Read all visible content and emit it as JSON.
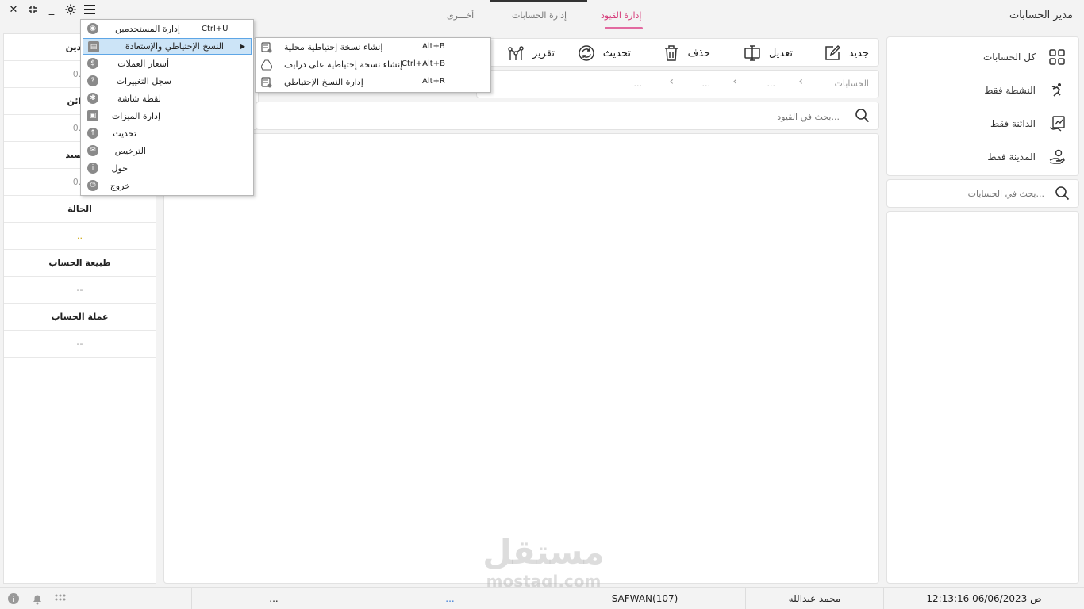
{
  "app": {
    "title": "مدير الحسابات"
  },
  "tabs": [
    {
      "label": "إدارة القيود",
      "active": true
    },
    {
      "label": "إدارة الحسابات",
      "active": false
    },
    {
      "label": "أخـــرى",
      "active": false
    }
  ],
  "window_controls": [
    "menu-icon",
    "gear-icon",
    "minimize-icon",
    "restore-icon",
    "close-icon"
  ],
  "sidebar": {
    "items": [
      {
        "label": "كل الحسابات",
        "icon": "grid-icon"
      },
      {
        "label": "النشطة فقط",
        "icon": "runner-icon"
      },
      {
        "label": "الدائنة فقط",
        "icon": "chart-hand-icon"
      },
      {
        "label": "المدينة فقط",
        "icon": "hand-coin-icon"
      }
    ],
    "search_placeholder": "بحث في الحسابات..."
  },
  "toolbar": {
    "new_label": "جديد",
    "edit_label": "تعديل",
    "delete_label": "حذف",
    "refresh_label": "تحديث",
    "report_label": "تقرير"
  },
  "breadcrumb": {
    "root": "الحسابات",
    "items": [
      "...",
      "...",
      "..."
    ]
  },
  "main_search": {
    "placeholder": "بحث في القيود..."
  },
  "details": {
    "rows": [
      {
        "head": "المدين",
        "value": "0.0"
      },
      {
        "head": "الدائن",
        "value": "0.0"
      },
      {
        "head": "الرصيد",
        "value": "0.0"
      },
      {
        "head": "الحالة",
        "value": ".."
      },
      {
        "head": "طبيعة الحساب",
        "value": "--"
      },
      {
        "head": "عملة الحساب",
        "value": "--"
      }
    ]
  },
  "menu": {
    "items": [
      {
        "label": "إدارة المستخدمين",
        "shortcut": "Ctrl+U",
        "icon": "users-icon"
      },
      {
        "label": "النسخ الإحتياطي والإستعادة",
        "shortcut": "",
        "icon": "backup-icon",
        "highlighted": true,
        "has_submenu": true
      },
      {
        "label": "أسعار العملات",
        "shortcut": "",
        "icon": "currency-icon"
      },
      {
        "label": "سجل التغييرات",
        "shortcut": "",
        "icon": "changelog-icon"
      },
      {
        "label": "لقطة شاشة",
        "shortcut": "",
        "icon": "screenshot-icon"
      },
      {
        "label": "إدارة الميزات",
        "shortcut": "",
        "icon": "features-icon"
      },
      {
        "label": "تحديث",
        "shortcut": "",
        "icon": "update-icon"
      },
      {
        "label": "الترخيص",
        "shortcut": "",
        "icon": "license-icon"
      },
      {
        "label": "حول",
        "shortcut": "",
        "icon": "info-icon"
      },
      {
        "label": "خروج",
        "shortcut": "",
        "icon": "power-icon"
      }
    ]
  },
  "submenu": {
    "items": [
      {
        "label": "إنشاء نسخة إحتياطية محلية",
        "shortcut": "Alt+B",
        "icon": "local-backup-icon"
      },
      {
        "label": "إنشاء نسخة إحتياطية على درايف",
        "shortcut": "Ctrl+Alt+B",
        "icon": "drive-icon"
      },
      {
        "label": "إدارة النسخ الإحتياطي",
        "shortcut": "Alt+R",
        "icon": "backup-manage-icon"
      }
    ]
  },
  "statusbar": {
    "datetime": "12:13:16 06/06/2023 ص",
    "user": "محمد عبدالله",
    "machine": "SAFWAN(107)",
    "cell4": "...",
    "cell5": "..."
  },
  "watermark": {
    "ar": "مستقل",
    "en": "mostaql.com"
  }
}
